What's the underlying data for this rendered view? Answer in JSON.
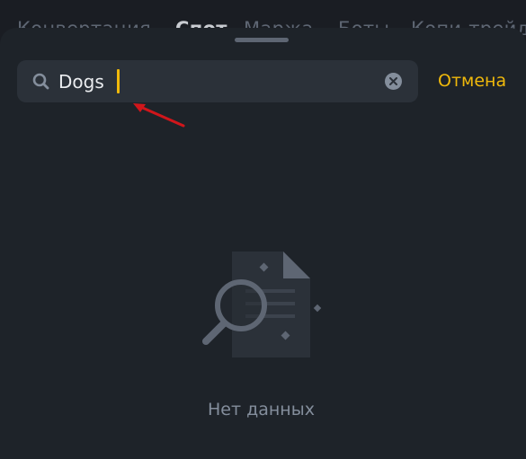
{
  "background_tabs": [
    {
      "label": "Конвертация",
      "active": false
    },
    {
      "label": "Спот",
      "active": true
    },
    {
      "label": "Маржа",
      "active": false
    },
    {
      "label": "Боты",
      "active": false
    },
    {
      "label": "Копи-трейдинг",
      "active": false
    }
  ],
  "search": {
    "value": "Dogs",
    "icon": "search-icon",
    "clear_icon": "clear-circle-icon"
  },
  "actions": {
    "cancel_label": "Отмена"
  },
  "empty_state": {
    "icon": "document-search-icon",
    "message": "Нет данных"
  },
  "colors": {
    "background": "#1e2329",
    "input": "#2b3139",
    "accent": "#f0b90b",
    "muted_text": "#848e9c",
    "annotation_arrow": "#d0161b"
  }
}
